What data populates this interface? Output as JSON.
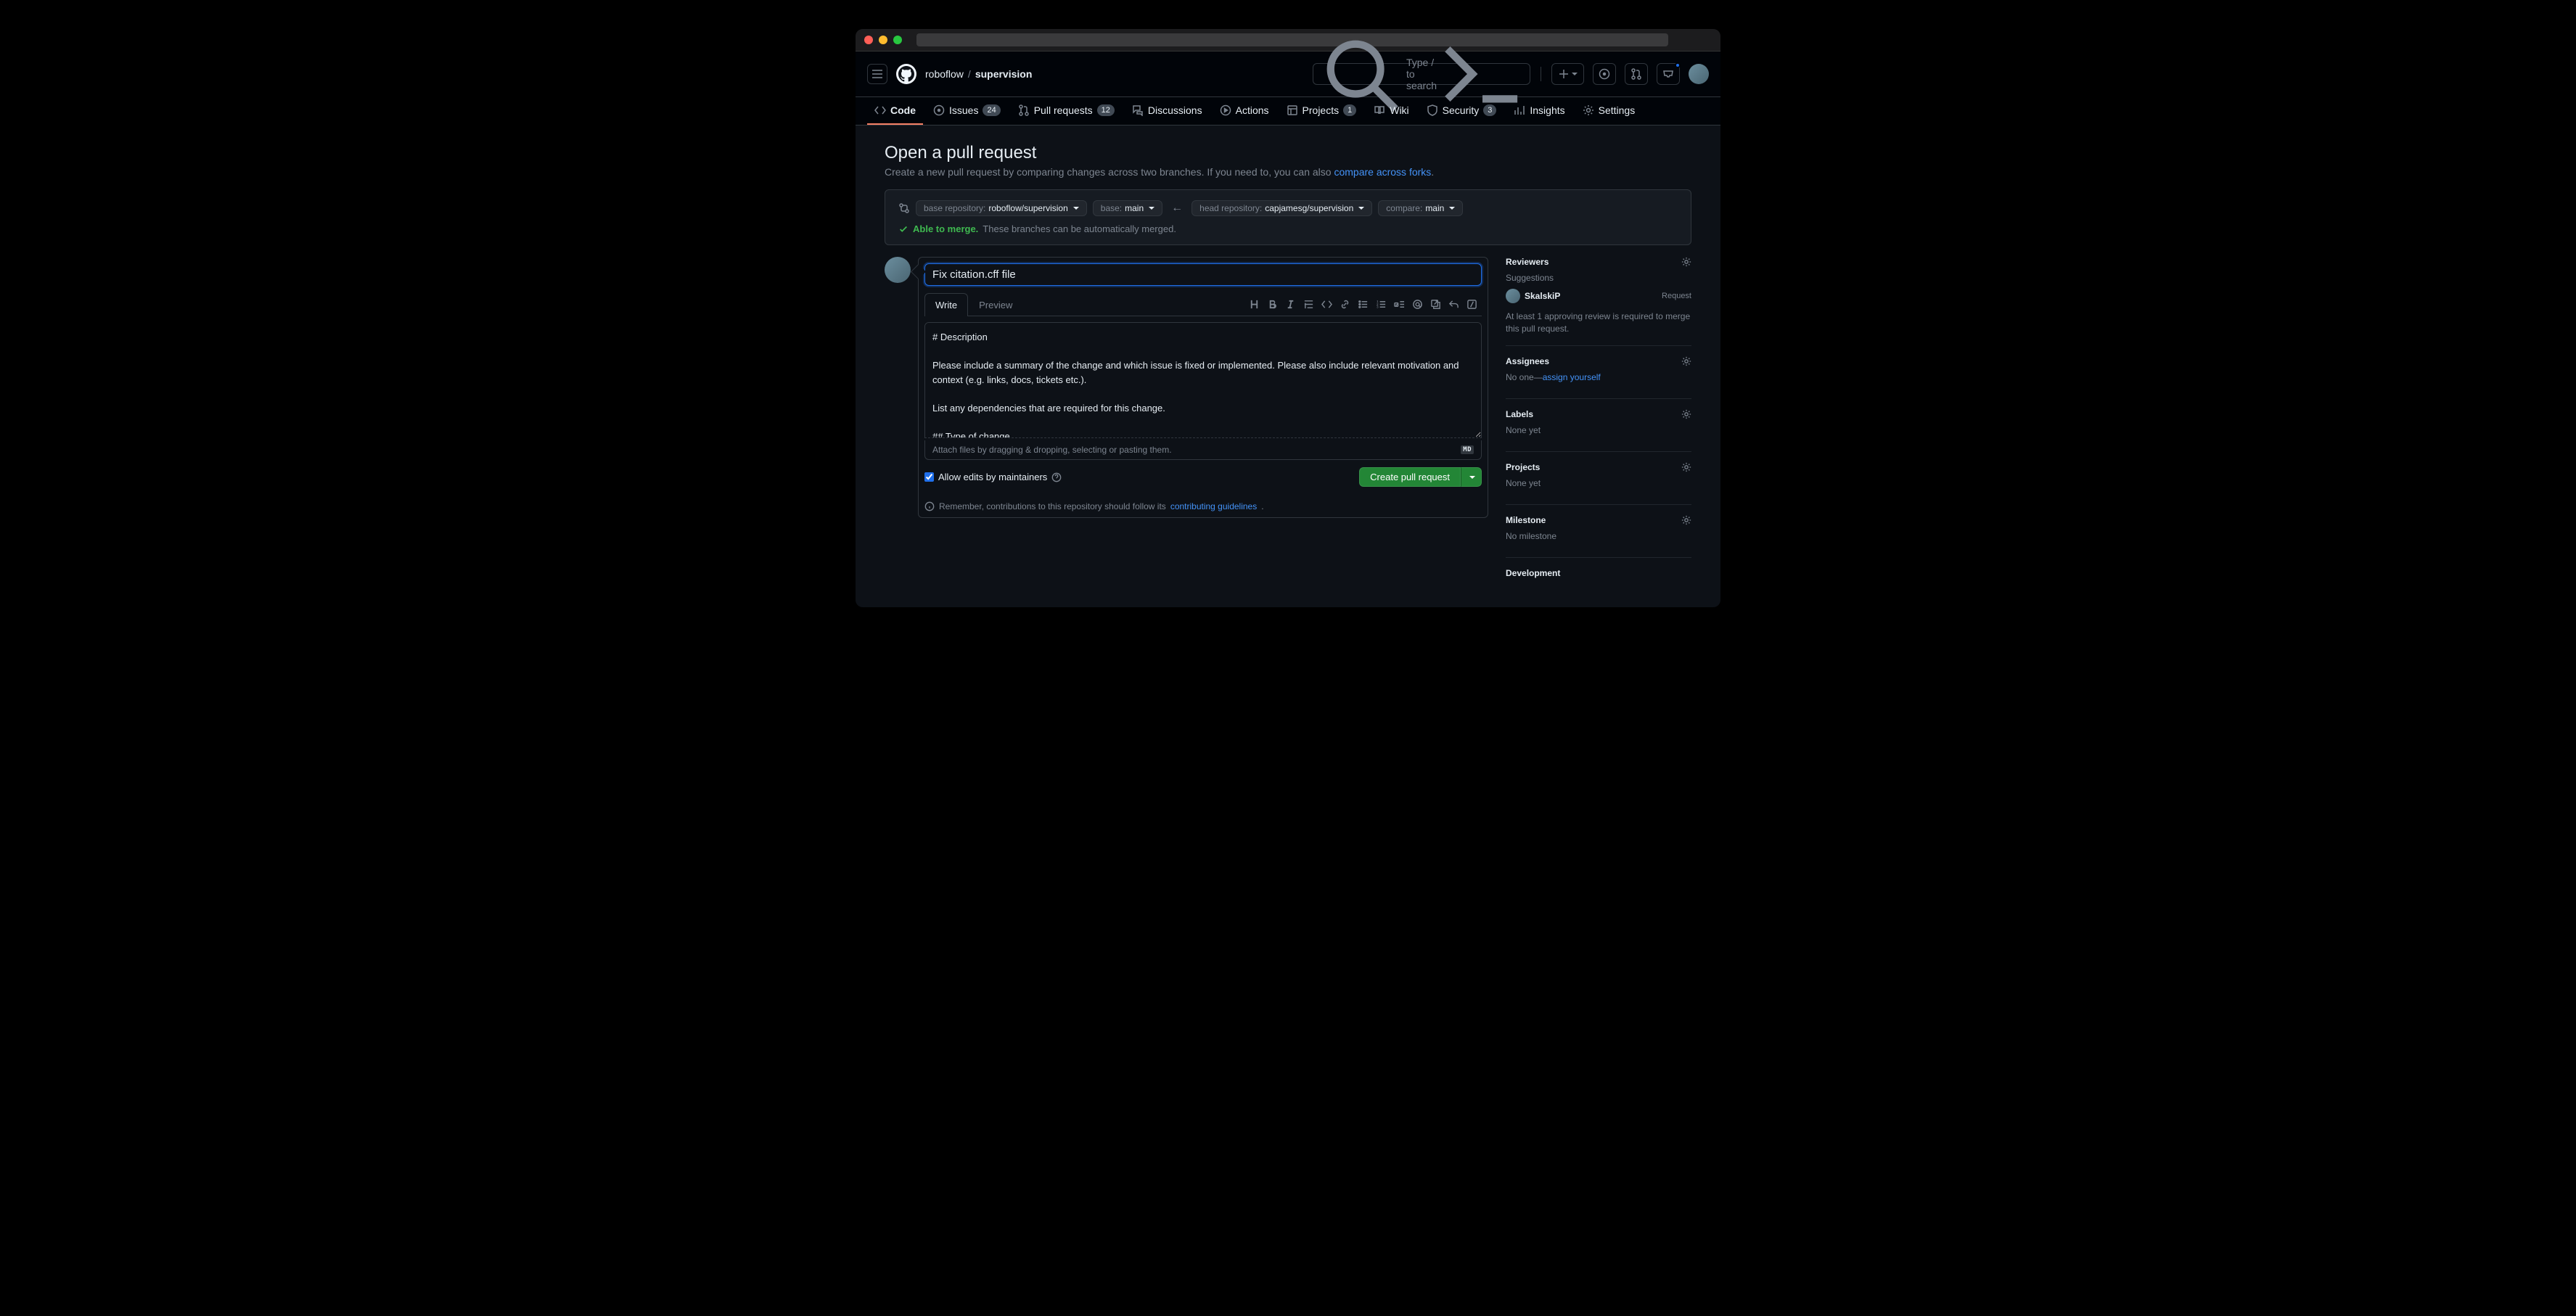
{
  "breadcrumb": {
    "owner": "roboflow",
    "repo": "supervision",
    "sep": "/"
  },
  "search": {
    "placeholder": "Type / to search"
  },
  "repo_nav": {
    "code": "Code",
    "issues": "Issues",
    "issues_count": "24",
    "pulls": "Pull requests",
    "pulls_count": "12",
    "discussions": "Discussions",
    "actions": "Actions",
    "projects": "Projects",
    "projects_count": "1",
    "wiki": "Wiki",
    "security": "Security",
    "security_count": "3",
    "insights": "Insights",
    "settings": "Settings"
  },
  "page": {
    "title": "Open a pull request",
    "sub_prefix": "Create a new pull request by comparing changes across two branches. If you need to, you can also ",
    "sub_link": "compare across forks",
    "sub_suffix": "."
  },
  "compare": {
    "base_repo_label": "base repository: ",
    "base_repo_value": "roboflow/supervision",
    "base_branch_label": "base: ",
    "base_branch_value": "main",
    "head_repo_label": "head repository: ",
    "head_repo_value": "capjamesg/supervision",
    "head_branch_label": "compare: ",
    "head_branch_value": "main",
    "arrow": "←",
    "merge_good": "Able to merge.",
    "merge_rest": " These branches can be automatically merged."
  },
  "form": {
    "title_value": "Fix citation.cff file",
    "tab_write": "Write",
    "tab_preview": "Preview",
    "body_value": "# Description\n\nPlease include a summary of the change and which issue is fixed or implemented. Please also include relevant motivation and context (e.g. links, docs, tickets etc.).\n\nList any dependencies that are required for this change.\n\n## Type of change",
    "attach_hint": "Attach files by dragging & dropping, selecting or pasting them.",
    "md_badge": "MD",
    "allow_edits": "Allow edits by maintainers",
    "create_btn": "Create pull request"
  },
  "footer": {
    "prefix": "Remember, contributions to this repository should follow its ",
    "link": "contributing guidelines",
    "suffix": "."
  },
  "sidebar": {
    "reviewers_title": "Reviewers",
    "suggestions": "Suggestions",
    "reviewer_name": "SkalskiP",
    "request": "Request",
    "review_note": "At least 1 approving review is required to merge this pull request.",
    "assignees_title": "Assignees",
    "assignees_none": "No one—",
    "assignees_link": "assign yourself",
    "labels_title": "Labels",
    "labels_none": "None yet",
    "projects_title": "Projects",
    "projects_none": "None yet",
    "milestone_title": "Milestone",
    "milestone_none": "No milestone",
    "development_title": "Development"
  }
}
